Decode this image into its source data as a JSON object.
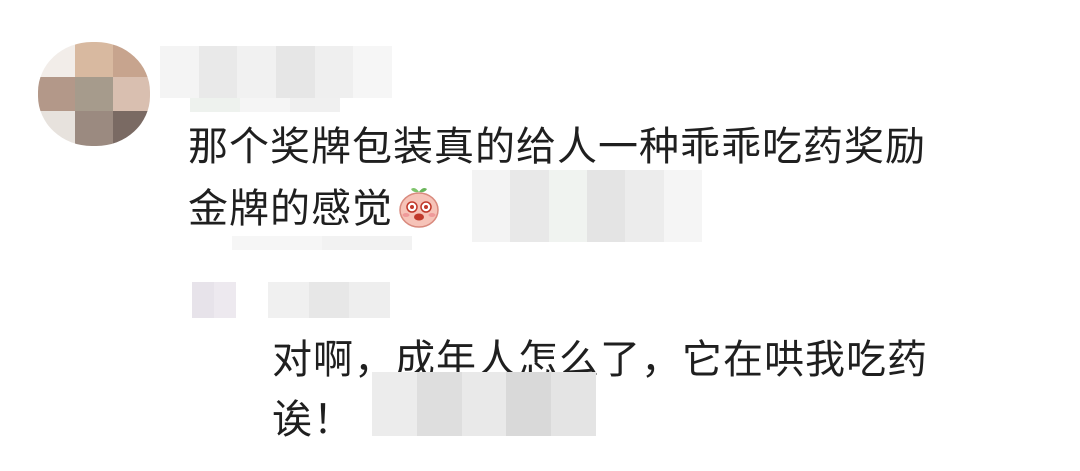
{
  "comment": {
    "text_line_1": "那个奖牌包装真的给人一种乖乖吃药奖励",
    "text_line_2": "金牌的感觉",
    "emoji_icon": "peach-crying-emoji"
  },
  "reply": {
    "text_line_1": "对啊，成年人怎么了，它在哄我吃药",
    "text_line_2": "诶！"
  },
  "colors": {
    "text": "#1f1f1f",
    "background": "#ffffff",
    "mosaic_light": "#eeeeee",
    "avatar_tone": "#c9a48c"
  }
}
